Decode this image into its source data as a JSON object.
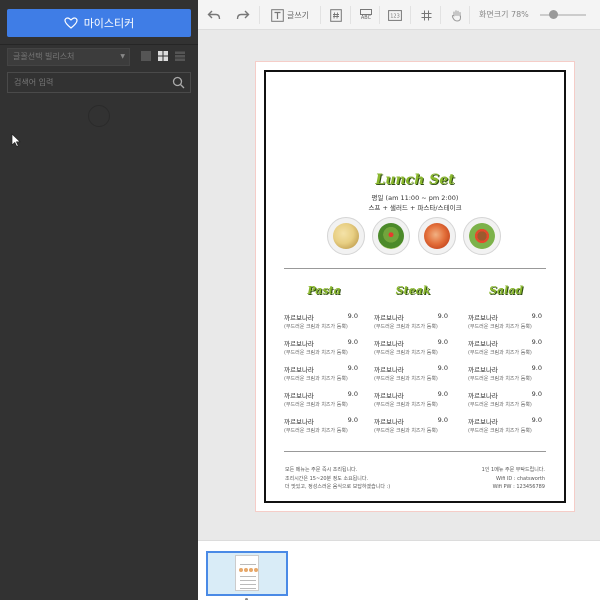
{
  "sidebar": {
    "mysticker_label": "마이스티커",
    "font_select_value": "글꼴선택 빌리스처",
    "search_placeholder": "검색어 입력"
  },
  "toolbar": {
    "text_label": "글쓰기",
    "abc_label": "ABC",
    "number_label": "123",
    "zoom_label": "화면크기 78%",
    "zoom_percent": 78
  },
  "menu": {
    "title": "Lunch Set",
    "hours": "평일 (am 11:00 ~ pm 2:00)",
    "course": "스프 + 샐러드 + 파스타/스테이크",
    "columns": [
      {
        "title": "Pasta",
        "items": [
          {
            "name": "까르보나라",
            "price": "9.0",
            "desc": "(부드러운 크림과 치즈가 듬뿍)"
          },
          {
            "name": "까르보나라",
            "price": "9.0",
            "desc": "(부드러운 크림과 치즈가 듬뿍)"
          },
          {
            "name": "까르보나라",
            "price": "9.0",
            "desc": "(부드러운 크림과 치즈가 듬뿍)"
          },
          {
            "name": "까르보나라",
            "price": "9.0",
            "desc": "(부드러운 크림과 치즈가 듬뿍)"
          },
          {
            "name": "까르보나라",
            "price": "9.0",
            "desc": "(부드러운 크림과 치즈가 듬뿍)"
          }
        ]
      },
      {
        "title": "Steak",
        "items": [
          {
            "name": "까르보나라",
            "price": "9.0",
            "desc": "(부드러운 크림과 치즈가 듬뿍)"
          },
          {
            "name": "까르보나라",
            "price": "9.0",
            "desc": "(부드러운 크림과 치즈가 듬뿍)"
          },
          {
            "name": "까르보나라",
            "price": "9.0",
            "desc": "(부드러운 크림과 치즈가 듬뿍)"
          },
          {
            "name": "까르보나라",
            "price": "9.0",
            "desc": "(부드러운 크림과 치즈가 듬뿍)"
          },
          {
            "name": "까르보나라",
            "price": "9.0",
            "desc": "(부드러운 크림과 치즈가 듬뿍)"
          }
        ]
      },
      {
        "title": "Salad",
        "items": [
          {
            "name": "까르보나라",
            "price": "9.0",
            "desc": "(부드러운 크림과 치즈가 듬뿍)"
          },
          {
            "name": "까르보나라",
            "price": "9.0",
            "desc": "(부드러운 크림과 치즈가 듬뿍)"
          },
          {
            "name": "까르보나라",
            "price": "9.0",
            "desc": "(부드러운 크림과 치즈가 듬뿍)"
          },
          {
            "name": "까르보나라",
            "price": "9.0",
            "desc": "(부드러운 크림과 치즈가 듬뿍)"
          },
          {
            "name": "까르보나라",
            "price": "9.0",
            "desc": "(부드러운 크림과 치즈가 듬뿍)"
          }
        ]
      }
    ],
    "footer_left": [
      "모든 메뉴는 주문 즉시 조리됩니다.",
      "조리시간은 15~20분 정도 소요됩니다.",
      "더 맛있고, 정성스러운 음식으로 보답하겠습니다 :)"
    ],
    "footer_right": [
      "1인 1메뉴 주문 부탁드립니다.",
      "Wifi ID : chatsworth",
      "Wifi PW : 123456789"
    ]
  },
  "colors": {
    "accent_blue": "#3f7de6",
    "title_green": "#8ab82e"
  },
  "icons": {
    "mysticker": "heart-icon",
    "search": "search-icon",
    "undo": "undo-icon",
    "redo": "redo-icon"
  }
}
